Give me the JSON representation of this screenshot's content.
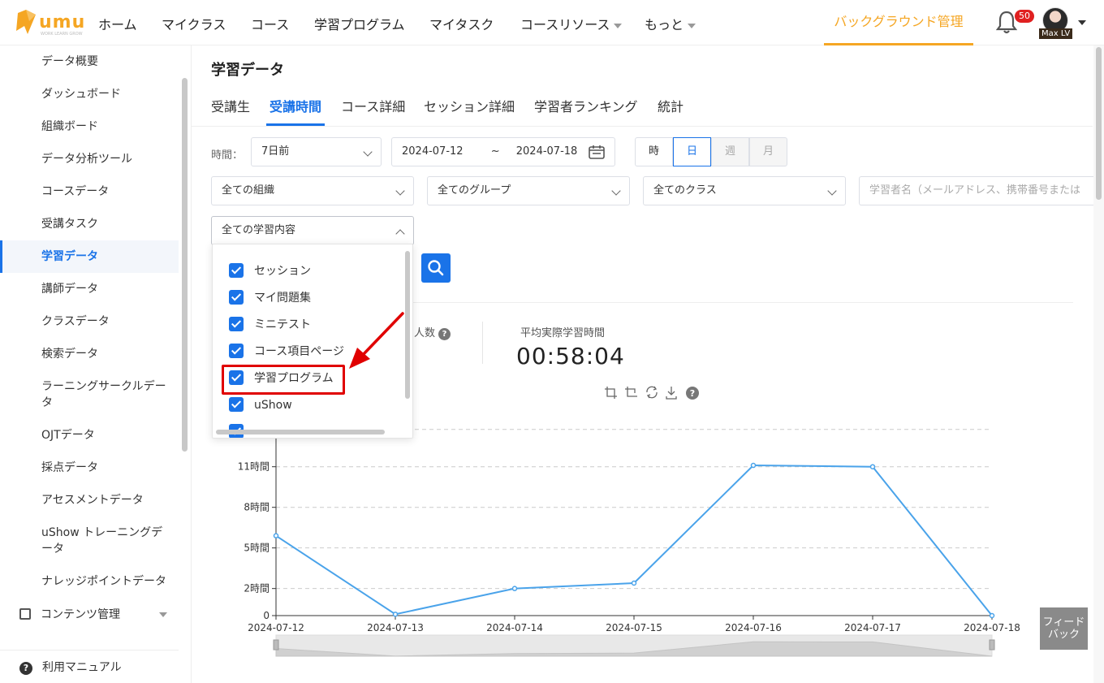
{
  "nav": {
    "logo_text": "umu",
    "logo_sub": "WORK LEARN GROW",
    "items": [
      {
        "label": "ホーム",
        "has_caret": false
      },
      {
        "label": "マイクラス",
        "has_caret": false
      },
      {
        "label": "コース",
        "has_caret": false
      },
      {
        "label": "学習プログラム",
        "has_caret": false
      },
      {
        "label": "マイタスク",
        "has_caret": false
      },
      {
        "label": "コースリソース",
        "has_caret": true
      },
      {
        "label": "もっと",
        "has_caret": true
      }
    ],
    "background_manage": "バックグラウンド管理",
    "notification_count": "50",
    "user_name": "Max LV",
    "accent": "#f5a623"
  },
  "sidebar": {
    "items": [
      {
        "label": "データ概要"
      },
      {
        "label": "ダッシュボード"
      },
      {
        "label": "組織ボード"
      },
      {
        "label": "データ分析ツール"
      },
      {
        "label": "コースデータ"
      },
      {
        "label": "受講タスク"
      },
      {
        "label": "学習データ",
        "active": true
      },
      {
        "label": "講師データ"
      },
      {
        "label": "クラスデータ"
      },
      {
        "label": "検索データ"
      },
      {
        "label": "ラーニングサークルデータ"
      },
      {
        "label": "OJTデータ"
      },
      {
        "label": "採点データ"
      },
      {
        "label": "アセスメントデータ"
      },
      {
        "label": "uShow トレーニングデータ"
      },
      {
        "label": "ナレッジポイントデータ"
      }
    ],
    "group_label": "コンテンツ管理",
    "manual": "利用マニュアル"
  },
  "main": {
    "title": "学習データ",
    "tabs": [
      {
        "label": "受講生"
      },
      {
        "label": "受講時間",
        "active": true
      },
      {
        "label": "コース詳細"
      },
      {
        "label": "セッション詳細"
      },
      {
        "label": "学習者ランキング"
      },
      {
        "label": "統計"
      }
    ],
    "filters": {
      "time_label": "時間：",
      "period": "7日前",
      "date_start": "2024-07-12",
      "date_sep": "~",
      "date_end": "2024-07-18",
      "granularity": [
        "時",
        "日",
        "週",
        "月"
      ],
      "granularity_selected": "日",
      "org": "全ての組織",
      "group": "全てのグループ",
      "class": "全てのクラス",
      "learner_placeholder": "学習者名（メールアドレス、携帯番号または",
      "content": "全ての学習内容"
    },
    "stats": {
      "left_label_visible": "人数",
      "avg_label": "平均実際学習時間",
      "avg_value": "00:58:04"
    },
    "dropdown": {
      "options": [
        {
          "label": "セッション",
          "checked": true
        },
        {
          "label": "マイ問題集",
          "checked": true
        },
        {
          "label": "ミニテスト",
          "checked": true
        },
        {
          "label": "コース項目ページ",
          "checked": true
        },
        {
          "label": "学習プログラム",
          "checked": true,
          "highlighted": true
        },
        {
          "label": "uShow",
          "checked": true
        }
      ]
    },
    "feedback": "フィードバック"
  },
  "chart_data": {
    "type": "line",
    "x": [
      "2024-07-12",
      "2024-07-13",
      "2024-07-14",
      "2024-07-15",
      "2024-07-16",
      "2024-07-17",
      "2024-07-18"
    ],
    "y_hours": [
      5.9,
      0.1,
      2.0,
      2.4,
      11.1,
      11.0,
      0.0
    ],
    "y_ticks": [
      {
        "v": 0,
        "label": "0"
      },
      {
        "v": 2,
        "label": "2時間"
      },
      {
        "v": 5,
        "label": "5時間"
      },
      {
        "v": 8,
        "label": "8時間"
      },
      {
        "v": 11,
        "label": "11時間"
      }
    ],
    "ylim": [
      0,
      14
    ],
    "grid": true,
    "line_color": "#4aa3ea"
  }
}
